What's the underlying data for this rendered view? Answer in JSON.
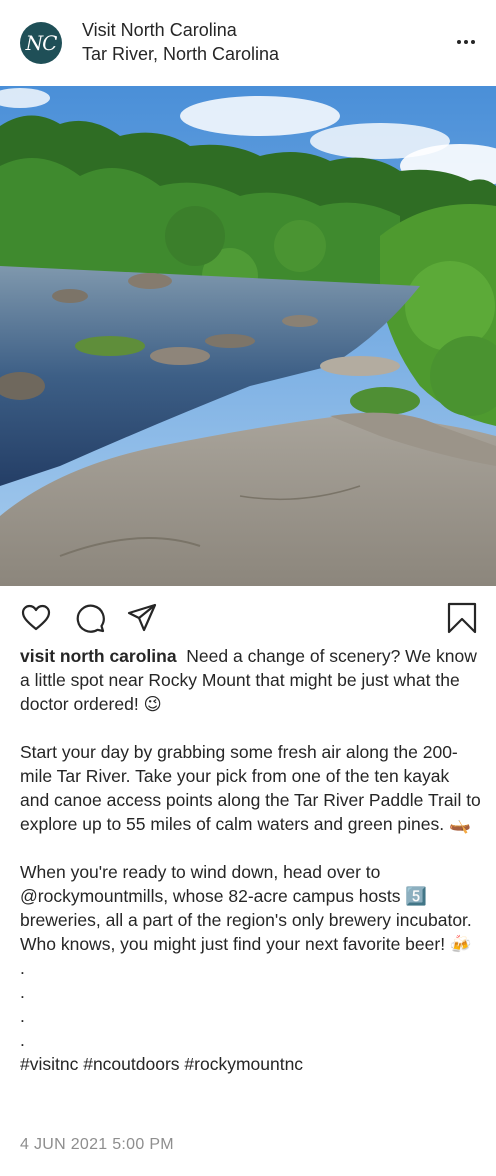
{
  "post": {
    "account_name": "Visit North Carolina",
    "avatar_text": "NC",
    "location": "Tar River, North Carolina",
    "more_icon": "more-horizontal-icon",
    "photo_alt": "Tar River rocks and rapids with green trees",
    "actions": {
      "like_icon": "heart-icon",
      "comment_icon": "comment-icon",
      "share_icon": "paper-plane-icon",
      "save_icon": "bookmark-icon"
    },
    "caption_user": "visit north carolina",
    "caption_text": "  Need a change of scenery? We know a little spot near Rocky Mount that might be just what the doctor ordered! 😉\n\nStart your day by grabbing some fresh air along the 200-mile Tar River. Take your pick from one of the ten kayak and canoe access points along the Tar River Paddle Trail to explore up to 55 miles of calm waters and green pines. 🛶\n\nWhen you're ready to wind down, head over to @rockymountmills, whose 82-acre campus hosts 5️⃣ breweries, all a part of the region's only brewery incubator. Who knows, you might just find your next favorite beer! 🍻\n.\n.\n.\n.\n#visitnc #ncoutdoors #rockymountnc",
    "timestamp": "4 JUN 2021 5:00 PM"
  }
}
